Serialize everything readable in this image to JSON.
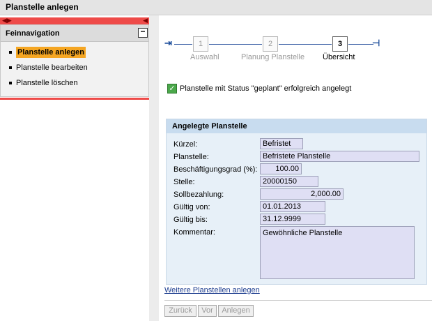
{
  "window": {
    "title": "Planstelle anlegen"
  },
  "sidebar": {
    "header": "Feinnavigation",
    "collapse_symbol": "−",
    "items": [
      {
        "label": "Planstelle anlegen",
        "active": true
      },
      {
        "label": "Planstelle bearbeiten",
        "active": false
      },
      {
        "label": "Planstelle löschen",
        "active": false
      }
    ]
  },
  "wizard": {
    "steps": [
      {
        "number": "1",
        "label": "Auswahl",
        "current": false
      },
      {
        "number": "2",
        "label": "Planung Planstelle",
        "current": false
      },
      {
        "number": "3",
        "label": "Übersicht",
        "current": true
      }
    ]
  },
  "message": {
    "text": "Planstelle mit Status \"geplant\" erfolgreich angelegt",
    "icon": "check-icon",
    "color": "#4ba84b"
  },
  "form": {
    "title": "Angelegte Planstelle",
    "fields": {
      "kuerzel": {
        "label": "Kürzel:",
        "value": "Befristet"
      },
      "planstelle": {
        "label": "Planstelle:",
        "value": "Befristete Planstelle"
      },
      "beschaeftigungsgrad": {
        "label": "Beschäftigungsgrad (%):",
        "value": "100.00"
      },
      "stelle": {
        "label": "Stelle:",
        "value": "20000150"
      },
      "sollbezahlung": {
        "label": "Sollbezahlung:",
        "value": "2,000.00"
      },
      "gueltig_von": {
        "label": "Gültig von:",
        "value": "01.01.2013"
      },
      "gueltig_bis": {
        "label": "Gültig bis:",
        "value": "31.12.9999"
      },
      "kommentar": {
        "label": "Kommentar:",
        "value": "Gewöhnliche Planstelle"
      }
    }
  },
  "links": {
    "more": "Weitere Planstellen anlegen"
  },
  "buttons": {
    "back": "Zurück",
    "next": "Vor",
    "create": "Anlegen"
  },
  "colors": {
    "accent_red": "#ee4a48",
    "active_nav": "#f5a623",
    "panel_blue": "#e7f0f8",
    "header_blue": "#c8dcef"
  }
}
